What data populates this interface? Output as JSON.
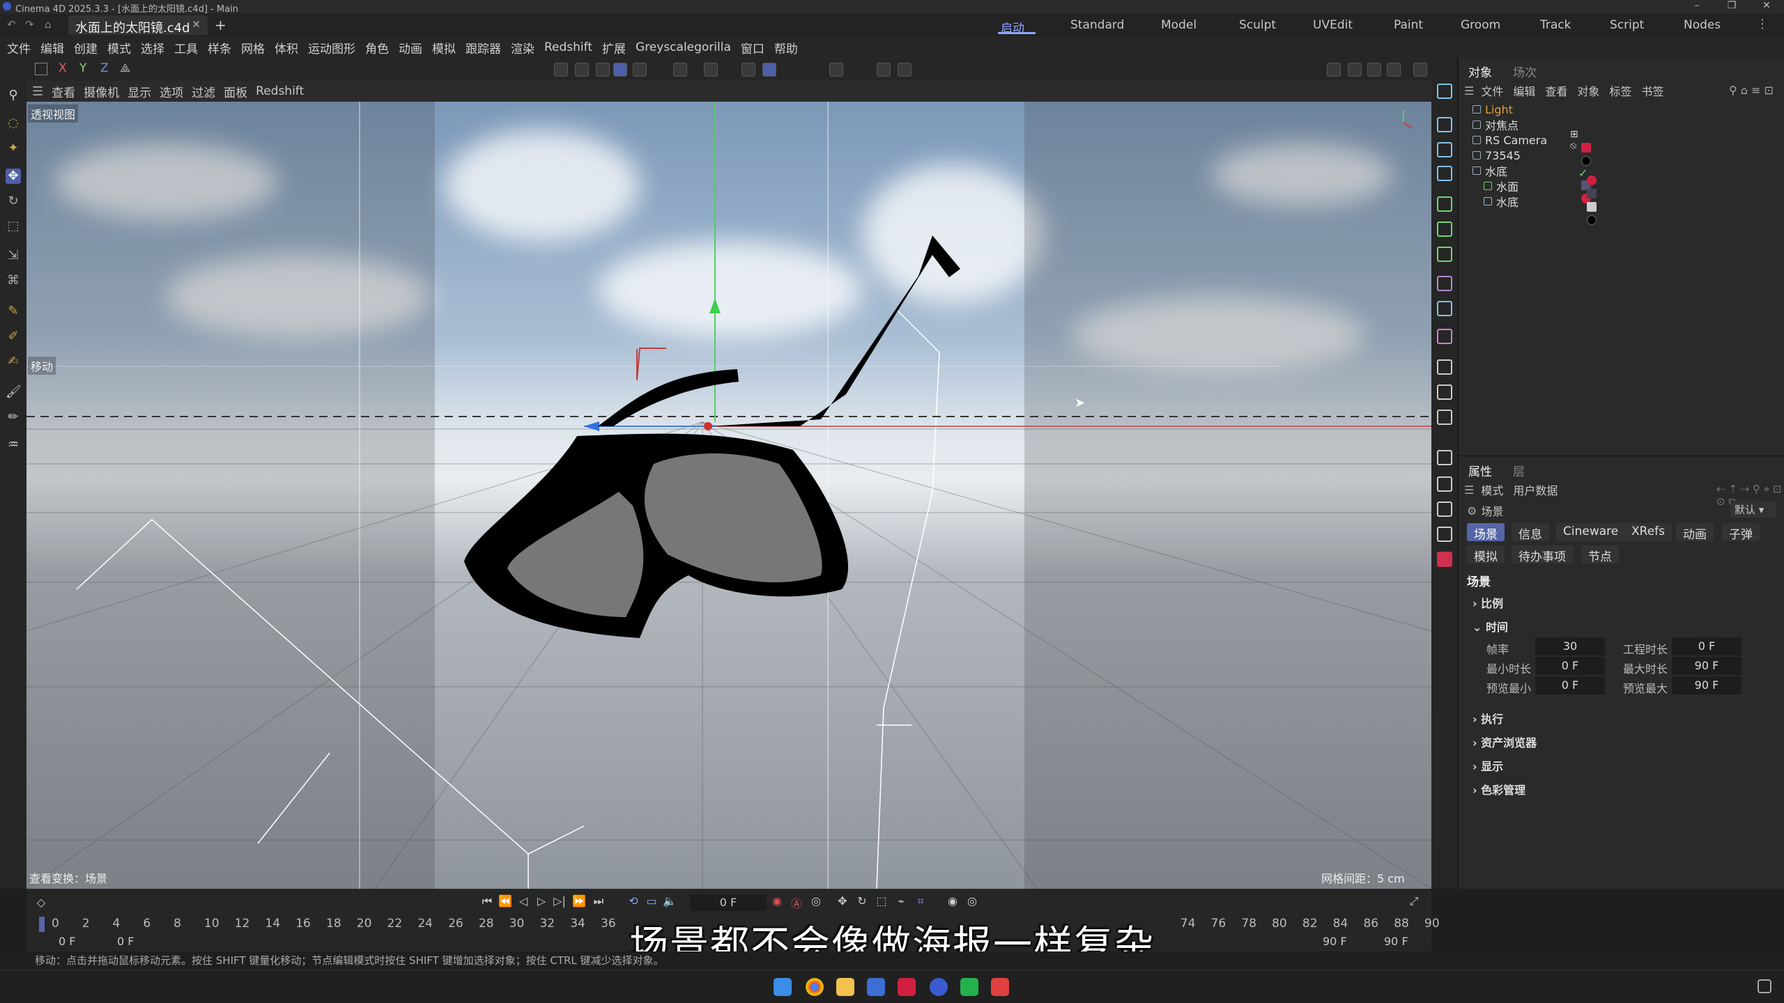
{
  "window": {
    "title": "Cinema 4D 2025.3.3 - [水面上的太阳镜.c4d] - Main",
    "document_tab": "水面上的太阳镜.c4d",
    "new_tab": "+"
  },
  "layouts": [
    {
      "label": "启动",
      "active": true
    },
    {
      "label": "Standard"
    },
    {
      "label": "Model"
    },
    {
      "label": "Sculpt"
    },
    {
      "label": "UVEdit"
    },
    {
      "label": "Paint"
    },
    {
      "label": "Groom"
    },
    {
      "label": "Track"
    },
    {
      "label": "Script"
    },
    {
      "label": "Nodes"
    }
  ],
  "menu": [
    "文件",
    "编辑",
    "创建",
    "模式",
    "选择",
    "工具",
    "样条",
    "网格",
    "体积",
    "运动图形",
    "角色",
    "动画",
    "模拟",
    "跟踪器",
    "渲染",
    "Redshift",
    "扩展",
    "Greyscalegorilla",
    "窗口",
    "帮助"
  ],
  "axis_buttons": [
    "X",
    "Y",
    "Z"
  ],
  "viewport_menu": [
    "查看",
    "摄像机",
    "显示",
    "选项",
    "过滤",
    "面板",
    "Redshift"
  ],
  "viewport": {
    "name": "透视视图",
    "move_label": "移动",
    "transform_info": "查看变换：场景",
    "grid_spacing": "网格间距：5 cm"
  },
  "object_manager": {
    "tabs": [
      "对象",
      "场次"
    ],
    "menu": [
      "文件",
      "编辑",
      "查看",
      "对象",
      "标签",
      "书签"
    ],
    "objects": [
      {
        "name": "Light",
        "highlight": true
      },
      {
        "name": "对焦点"
      },
      {
        "name": "RS Camera"
      },
      {
        "name": "73545"
      },
      {
        "name": "水底"
      },
      {
        "name": "水面"
      },
      {
        "name": "水底"
      }
    ]
  },
  "attributes": {
    "tabs": [
      "属性",
      "层"
    ],
    "menu": [
      "模式",
      "用户数据"
    ],
    "object_label": "场景",
    "preset": "默认",
    "buttons_row1": [
      "场景",
      "信息",
      "Cineware",
      "XRefs",
      "动画",
      "子弹"
    ],
    "buttons_row2": [
      "模拟",
      "待办事项",
      "节点"
    ],
    "section_title": "场景",
    "sections": {
      "scale": "比例",
      "time": "时间",
      "execute": "执行",
      "asset_browser": "资产浏览器",
      "display": "显示",
      "color_mgmt": "色彩管理"
    },
    "fields": {
      "fps_label": "帧率",
      "fps": "30",
      "project_length_label": "工程时长",
      "project_length": "0 F",
      "min_label": "最小时长",
      "min": "0 F",
      "max_label": "最大时长",
      "max": "90 F",
      "preview_min_label": "预览最小",
      "preview_min": "0 F",
      "preview_max_label": "预览最大",
      "preview_max": "90 F"
    }
  },
  "timeline": {
    "current_frame": "0 F",
    "ticks": [
      "0",
      "2",
      "4",
      "6",
      "8",
      "10",
      "12",
      "14",
      "16",
      "18",
      "20",
      "22",
      "24",
      "26",
      "28",
      "30",
      "32",
      "34",
      "36",
      "74",
      "76",
      "78",
      "80",
      "82",
      "84",
      "86",
      "88",
      "90"
    ],
    "start_a": "0 F",
    "start_b": "0 F",
    "end_a": "90 F",
    "end_b": "90 F"
  },
  "status_text": "移动：点击并拖动鼠标移动元素。按住 SHIFT 键量化移动；节点编辑模式时按住 SHIFT 键增加选择对象；按住 CTRL 键减少选择对象。",
  "subtitle": "场景都不会像做海报一样复杂",
  "colors": {
    "accent": "#5566a8",
    "light_highlight": "#e0a030"
  }
}
